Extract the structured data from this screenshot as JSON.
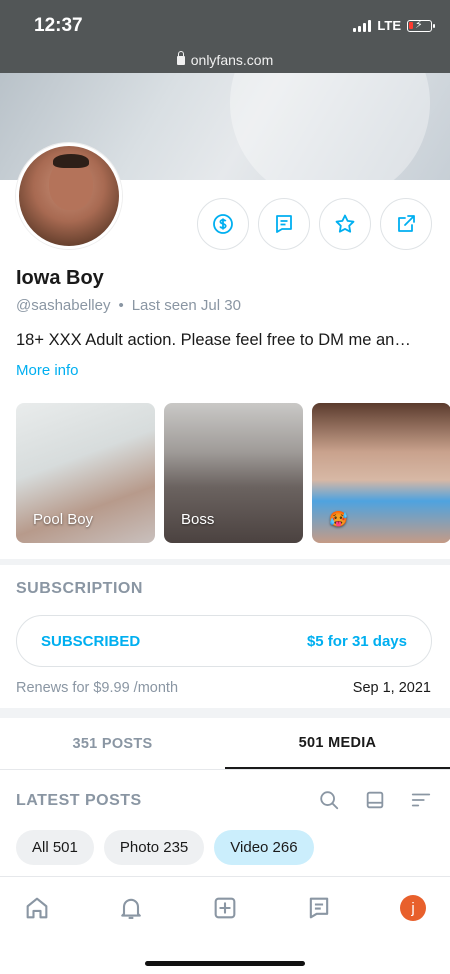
{
  "status_bar": {
    "time": "12:37",
    "network": "LTE"
  },
  "browser": {
    "url": "onlyfans.com"
  },
  "profile": {
    "name": "Iowa Boy",
    "handle": "@sashabelley",
    "separator": "•",
    "last_seen": "Last seen Jul 30",
    "bio": "18+ XXX Adult action. Please feel free to DM me an…",
    "more_info": "More info"
  },
  "actions": [
    {
      "name": "tip-button",
      "icon": "dollar-icon"
    },
    {
      "name": "message-button",
      "icon": "chat-icon"
    },
    {
      "name": "favorite-button",
      "icon": "star-icon"
    },
    {
      "name": "share-button",
      "icon": "share-icon"
    }
  ],
  "highlights": [
    {
      "label": "Pool Boy"
    },
    {
      "label": "Boss"
    },
    {
      "label": "🥵"
    }
  ],
  "subscription": {
    "title": "SUBSCRIPTION",
    "status": "SUBSCRIBED",
    "price": "$5 for 31 days",
    "renew_text": "Renews for $9.99 /month",
    "renew_date": "Sep 1, 2021"
  },
  "tabs": [
    {
      "label": "351 POSTS",
      "active": false
    },
    {
      "label": "501 MEDIA",
      "active": true
    }
  ],
  "latest": {
    "title": "LATEST POSTS",
    "filters": [
      {
        "label": "All 501",
        "active": false
      },
      {
        "label": "Photo 235",
        "active": false
      },
      {
        "label": "Video 266",
        "active": true
      }
    ]
  },
  "bottom_nav": {
    "avatar_initial": "j"
  },
  "colors": {
    "accent": "#00aff0",
    "muted": "#8a96a3",
    "active_chip": "#cbeefc",
    "avatar": "#e8602c"
  }
}
